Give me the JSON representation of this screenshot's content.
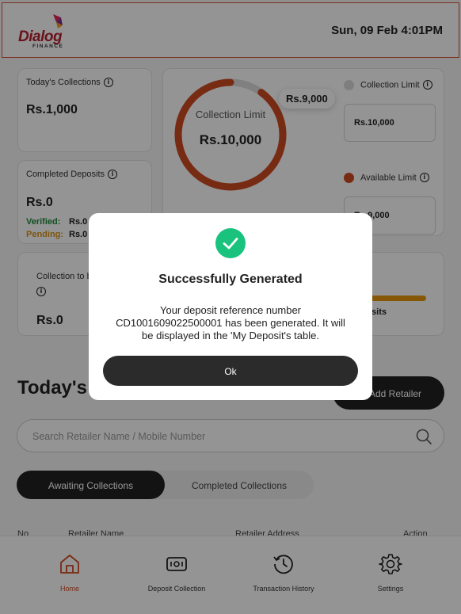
{
  "header": {
    "logo_text": "Dialog",
    "logo_subtext": "FINANCE",
    "datetime": "Sun, 09 Feb 4:01PM"
  },
  "cards": {
    "todays_collections": {
      "label": "Today's Collections",
      "value": "Rs.1,000"
    },
    "completed_deposits": {
      "label": "Completed Deposits",
      "value": "Rs.0",
      "verified_label": "Verified:",
      "verified_value": "Rs.0",
      "pending_label": "Pending:",
      "pending_value": "Rs.0"
    },
    "collection_to_bank": {
      "label": "Collection to b",
      "value": "Rs.0"
    },
    "limit_chart": {
      "center_label": "Collection Limit",
      "center_value": "Rs.10,000",
      "pill_value": "Rs.9,000",
      "used_fraction": 0.1
    },
    "collection_limit": {
      "label": "Collection Limit",
      "value": "Rs.10,000"
    },
    "available_limit": {
      "label": "Available Limit",
      "value": "Rs.9,000"
    },
    "visits": {
      "label": "isits",
      "progress_fraction": 1.0
    }
  },
  "retailers": {
    "title": "Today's V",
    "add_button": "Add Retailer",
    "search_placeholder": "Search Retailer Name / Mobile Number"
  },
  "tabs": {
    "awaiting": "Awaiting Collections",
    "completed": "Completed Collections"
  },
  "table": {
    "columns": [
      "No",
      "Retailer Name",
      "Retailer Address",
      "Action"
    ]
  },
  "bottom_nav": [
    {
      "label": "Home",
      "icon": "home-icon",
      "active": true
    },
    {
      "label": "Deposit Collection",
      "icon": "cash-icon",
      "active": false
    },
    {
      "label": "Transaction History",
      "icon": "history-icon",
      "active": false
    },
    {
      "label": "Settings",
      "icon": "gear-icon",
      "active": false
    }
  ],
  "modal": {
    "title": "Successfully Generated",
    "message": "Your deposit reference number CD1001609022500001 has been generated. It will be displayed in the 'My Deposit's table.",
    "ok_label": "Ok"
  },
  "colors": {
    "brand_red": "#b5202e",
    "accent_orange": "#cf4a22",
    "verified_green": "#1f8a3a",
    "pending_amber": "#d8941c",
    "success_green": "#19c37d",
    "dark": "#222222"
  }
}
